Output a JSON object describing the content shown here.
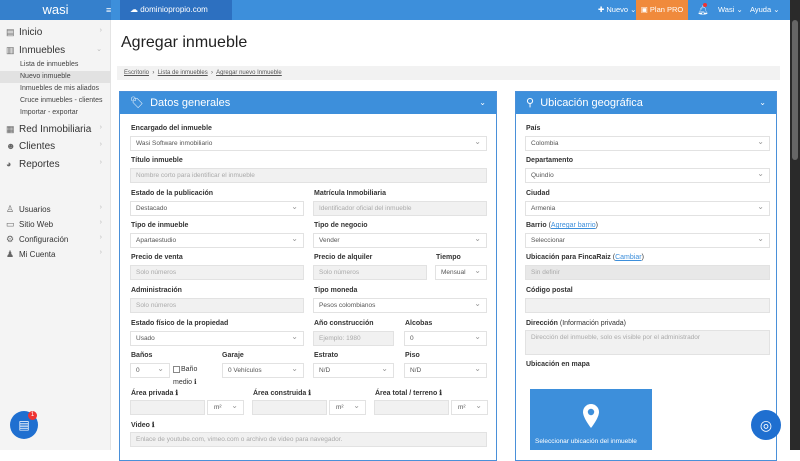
{
  "topbar": {
    "logo": "wasi",
    "domain": "dominiopropio.com",
    "nuevo": "Nuevo",
    "plan": "Plan PRO",
    "user": "Wasi",
    "help": "Ayuda"
  },
  "sidebar": {
    "main": [
      {
        "label": "Inicio"
      },
      {
        "label": "Inmuebles"
      },
      {
        "label": "Red Inmobiliaria"
      },
      {
        "label": "Clientes"
      },
      {
        "label": "Reportes"
      }
    ],
    "sub": [
      "Lista de inmuebles",
      "Nuevo inmueble",
      "Inmuebles de mis aliados",
      "Cruce inmuebles - clientes",
      "Importar - exportar"
    ],
    "bottom": [
      {
        "label": "Usuarios"
      },
      {
        "label": "Sitio Web"
      },
      {
        "label": "Configuración"
      },
      {
        "label": "Mi Cuenta"
      }
    ]
  },
  "page": {
    "title": "Agregar inmueble",
    "breadcrumb": [
      "Escritorio",
      "Lista de inmuebles",
      "Agregar nuevo Inmueble"
    ]
  },
  "general": {
    "title": "Datos generales",
    "encargado": {
      "label": "Encargado del inmueble",
      "value": "Wasi Software inmobiliario"
    },
    "titulo": {
      "label": "Título inmueble",
      "placeholder": "Nombre corto para identificar el inmueble"
    },
    "estado_pub": {
      "label": "Estado de la publicación",
      "value": "Destacado"
    },
    "matricula": {
      "label": "Matrícula Inmobiliaria",
      "placeholder": "Identificador oficial del inmueble"
    },
    "tipo_inmueble": {
      "label": "Tipo de inmueble",
      "value": "Apartaestudio"
    },
    "tipo_negocio": {
      "label": "Tipo de negocio",
      "value": "Vender"
    },
    "precio_venta": {
      "label": "Precio de venta",
      "placeholder": "Solo números"
    },
    "precio_alquiler": {
      "label": "Precio de alquiler",
      "placeholder": "Solo números"
    },
    "tiempo": {
      "label": "Tiempo",
      "value": "Mensual"
    },
    "administracion": {
      "label": "Administración",
      "placeholder": "Solo números"
    },
    "moneda": {
      "label": "Tipo moneda",
      "value": "Pesos colombianos"
    },
    "estado_fisico": {
      "label": "Estado físico de la propiedad",
      "value": "Usado"
    },
    "anio": {
      "label": "Año construcción",
      "placeholder": "Ejemplo: 1980"
    },
    "alcobas": {
      "label": "Alcobas",
      "value": "0"
    },
    "banos": {
      "label": "Baños",
      "value": "0",
      "medio_a": "Baño",
      "medio_b": "medio"
    },
    "garaje": {
      "label": "Garaje",
      "value": "0 Vehículos"
    },
    "estrato": {
      "label": "Estrato",
      "value": "N/D"
    },
    "piso": {
      "label": "Piso",
      "value": "N/D"
    },
    "area_privada": {
      "label": "Área privada",
      "unit": "m²"
    },
    "area_construida": {
      "label": "Área construida",
      "unit": "m²"
    },
    "area_total": {
      "label": "Área total / terreno",
      "unit": "m²"
    },
    "video": {
      "label": "Video",
      "placeholder": "Enlace de youtube.com, vimeo.com o archivo de video para navegador."
    }
  },
  "ubicacion": {
    "title": "Ubicación geográfica",
    "pais": {
      "label": "País",
      "value": "Colombia"
    },
    "departamento": {
      "label": "Departamento",
      "value": "Quindío"
    },
    "ciudad": {
      "label": "Ciudad",
      "value": "Armenia"
    },
    "barrio": {
      "label": "Barrio",
      "link": "Agregar barrio",
      "value": "Seleccionar"
    },
    "fincaraiz": {
      "label": "Ubicación para FincaRaiz",
      "link": "Cambiar",
      "value": "Sin definir"
    },
    "postal": {
      "label": "Código postal"
    },
    "direccion": {
      "label": "Dirección",
      "note": "(Información privada)",
      "placeholder": "Dirección del inmueble, solo es visible por el administrador"
    },
    "mapa": {
      "label": "Ubicación en mapa",
      "button": "Seleccionar ubicación del inmueble"
    }
  },
  "chat": {
    "badge": "1"
  }
}
